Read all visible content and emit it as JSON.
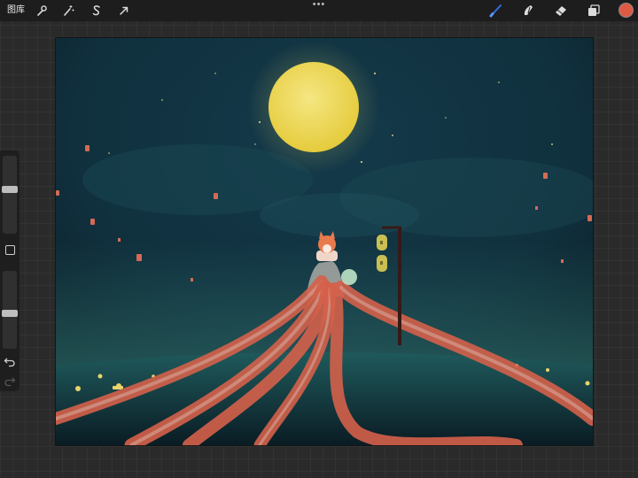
{
  "topbar": {
    "gallery_label": "图库",
    "left_tools": [
      {
        "name": "actions",
        "icon": "wrench-icon"
      },
      {
        "name": "adjustments",
        "icon": "magic-wand-icon"
      },
      {
        "name": "selection",
        "icon": "selection-s-icon"
      },
      {
        "name": "transform",
        "icon": "arrow-cursor-icon"
      }
    ],
    "more_menu": "•••",
    "right_tools": [
      {
        "name": "brush",
        "icon": "brush-icon",
        "active": true,
        "color": "#2f6fe4"
      },
      {
        "name": "smudge",
        "icon": "smudge-icon"
      },
      {
        "name": "eraser",
        "icon": "eraser-icon"
      },
      {
        "name": "layers",
        "icon": "layers-icon"
      }
    ],
    "current_color": "#de5a45"
  },
  "sidebar": {
    "brush_size_level": 0.42,
    "opacity_level": 0.55,
    "modify_button": "square-icon",
    "undo_icon": "undo-icon",
    "redo_icon": "redo-icon"
  },
  "canvas": {
    "artwork": "night-sky-moon-lanterns-painting"
  }
}
